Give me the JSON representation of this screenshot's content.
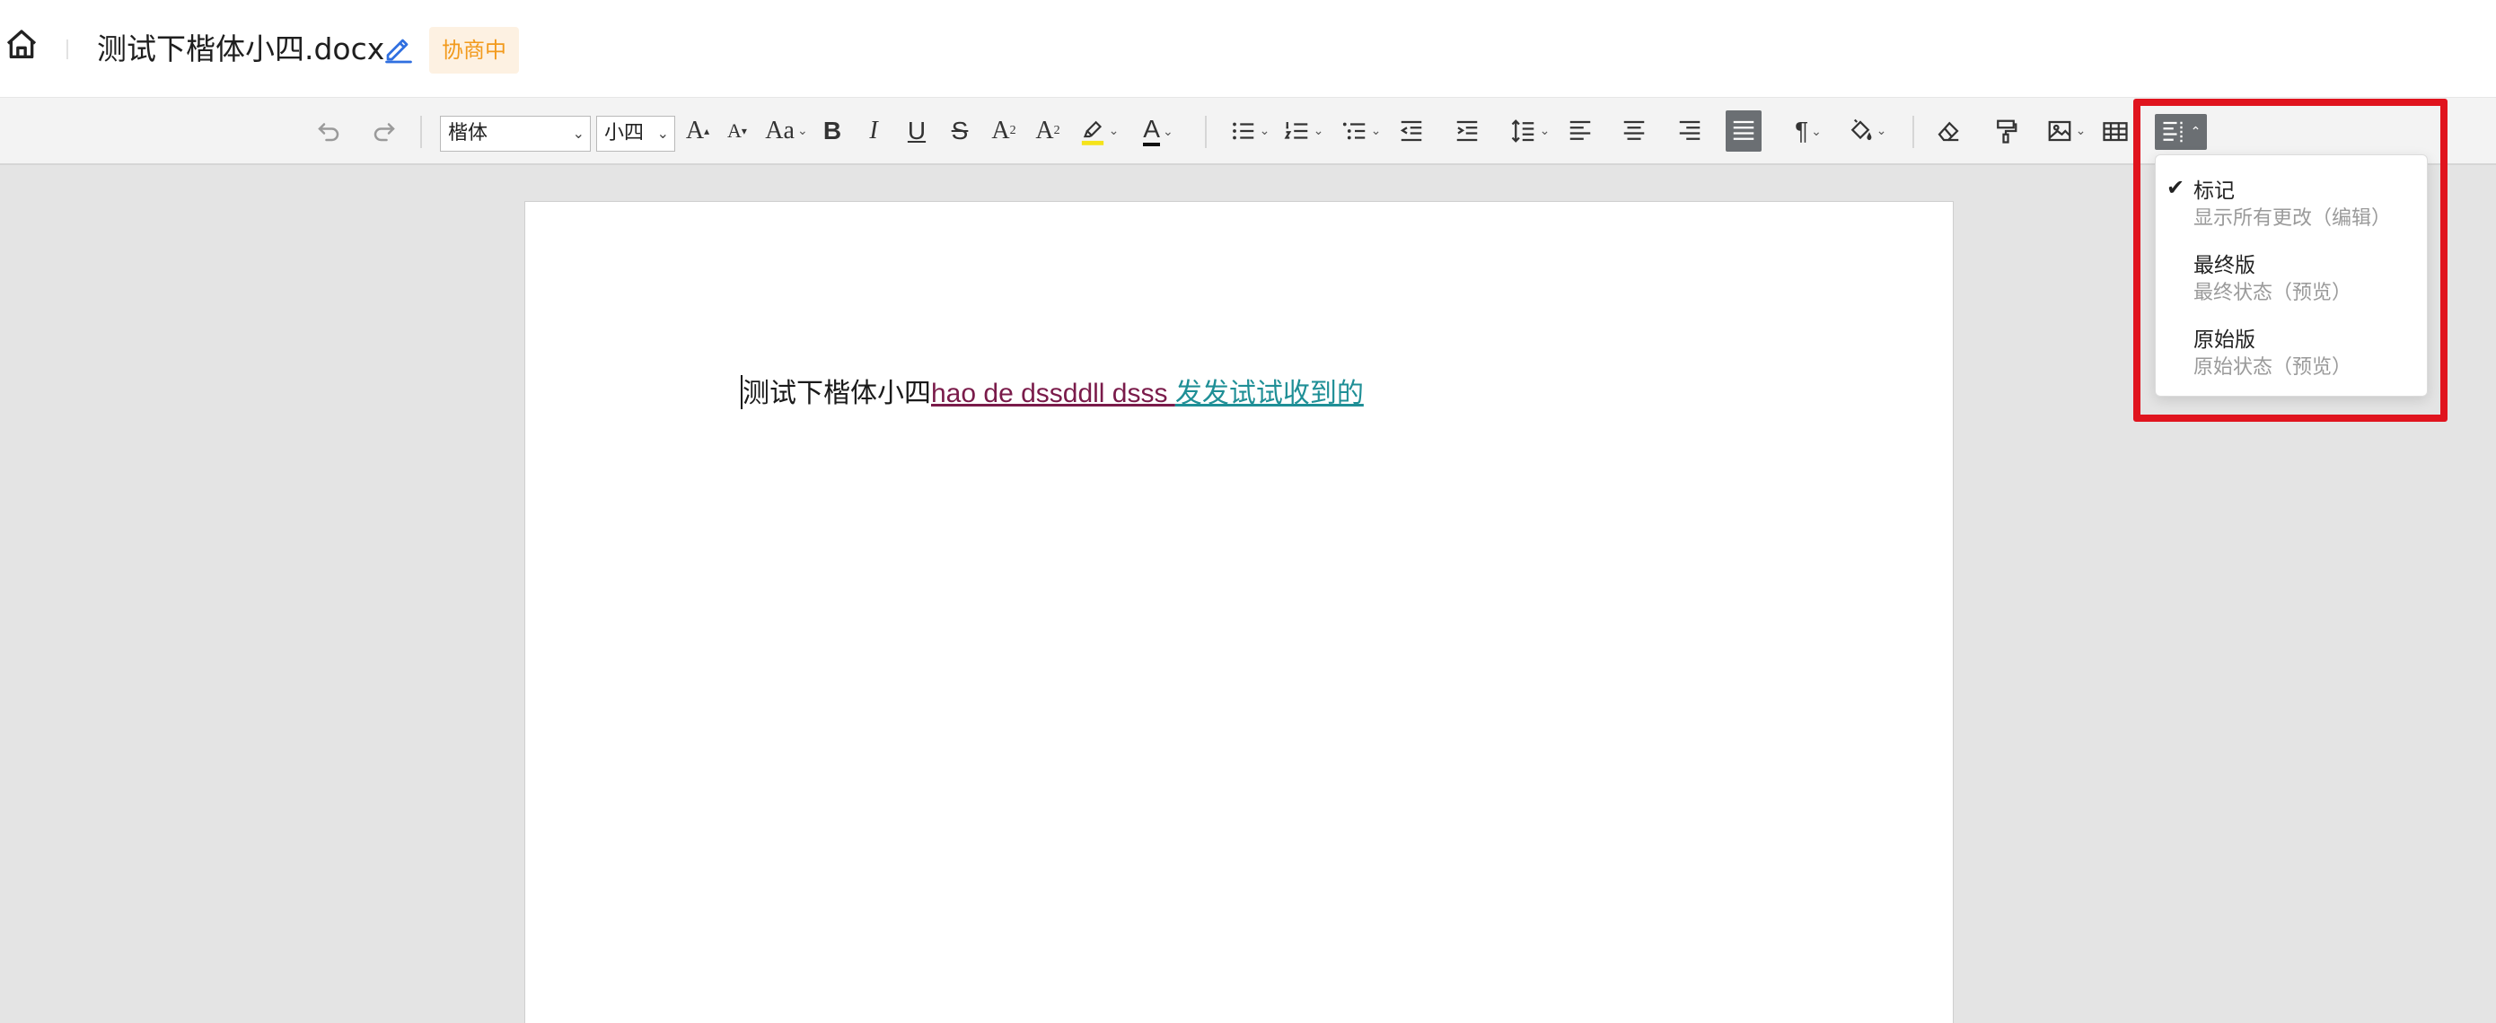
{
  "header": {
    "home_icon": "home-icon",
    "title": "测试下楷体小四.docx",
    "edit_icon": "pencil-icon",
    "status_badge": "协商中"
  },
  "toolbar": {
    "font_family": "楷体",
    "font_size": "小四",
    "buttons": {
      "undo": "undo-icon",
      "redo": "redo-icon",
      "grow_font": "A",
      "shrink_font": "A",
      "change_case": "Aa",
      "bold": "B",
      "italic": "I",
      "underline": "U",
      "strikethrough": "S",
      "superscript": "A",
      "subscript": "A",
      "highlight": "highlighter-icon",
      "font_color": "A",
      "bullet_list": "bullet-list-icon",
      "numbered_list": "numbered-list-icon",
      "multilevel_list": "multilevel-list-icon",
      "decrease_indent": "outdent-icon",
      "increase_indent": "indent-icon",
      "line_spacing": "line-spacing-icon",
      "align_left": "align-left-icon",
      "align_center": "align-center-icon",
      "align_right": "align-right-icon",
      "justify": "justify-icon",
      "paragraph_marks": "¶",
      "shading": "paint-bucket-icon",
      "clear_format": "eraser-icon",
      "format_painter": "format-painter-icon",
      "image": "image-icon",
      "table": "table-icon",
      "track_changes_view": "track-changes-icon"
    },
    "highlight_color": "#f5e31a",
    "font_color_value": "#111111"
  },
  "document": {
    "plain_text": "测试下楷体小四",
    "inserted_text_1": "hao de dssddll dsss ",
    "inserted_text_2": "发发试试收到的",
    "insert_color_1": "#7a1b4a",
    "insert_color_2": "#1f8f96"
  },
  "view_menu": {
    "items": [
      {
        "label": "标记",
        "description": "显示所有更改（编辑）",
        "checked": true
      },
      {
        "label": "最终版",
        "description": "最终状态（预览）",
        "checked": false
      },
      {
        "label": "原始版",
        "description": "原始状态（预览）",
        "checked": false
      }
    ],
    "check_mark": "✔",
    "highlight_color": "#e0141e"
  }
}
